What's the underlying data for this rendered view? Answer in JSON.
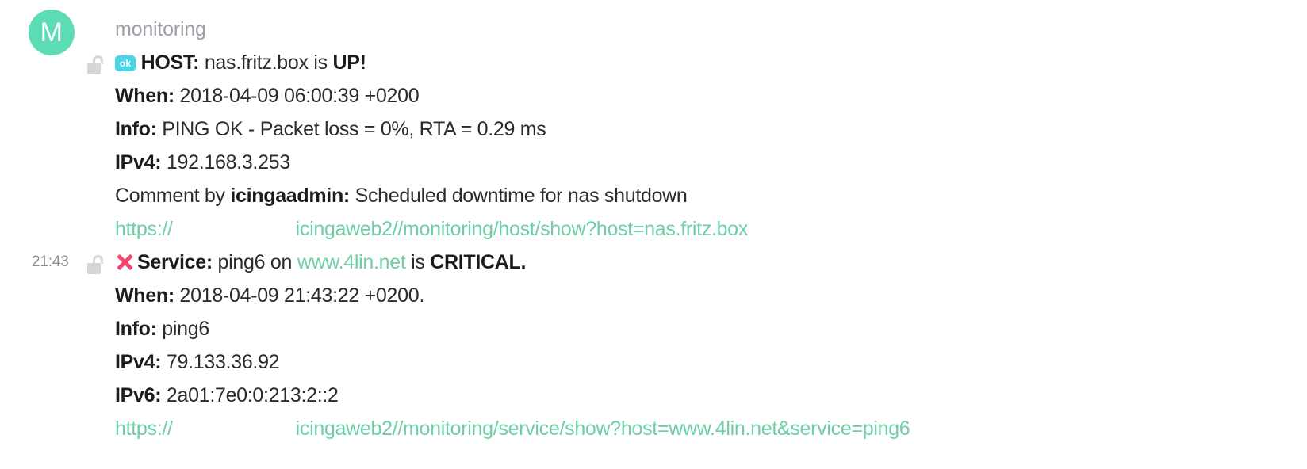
{
  "app": {
    "background_color": "#ffffff",
    "link_color": "#6ecfa4",
    "text_color": "#1d1c1d"
  },
  "message_group": {
    "avatar": {
      "initial": "M",
      "color": "#5bdcb4"
    },
    "sender": "monitoring"
  },
  "messages": [
    {
      "timestamp": "",
      "lock_icon": "unlocked-padlock-icon",
      "status_badge": {
        "label": "ok",
        "color": "#4ad5e6"
      },
      "title": {
        "prefix": "HOST:",
        "subject": " nas.fritz.box is ",
        "state": "UP!"
      },
      "fields": [
        {
          "label": "When:",
          "value": " 2018-04-09 06:00:39 +0200"
        },
        {
          "label": "Info:",
          "value": " PING OK - Packet loss = 0%, RTA = 0.29 ms"
        },
        {
          "label": "IPv4:",
          "value": " 192.168.3.253"
        }
      ],
      "comment": {
        "prefix": "Comment by ",
        "author": "icingaadmin:",
        "text": " Scheduled downtime for nas shutdown"
      },
      "url": {
        "scheme": "https://",
        "redacted": "",
        "path": "icingaweb2//monitoring/host/show?host=nas.fritz.box"
      }
    },
    {
      "timestamp": "21:43",
      "lock_icon": "unlocked-padlock-icon",
      "status_icon": {
        "name": "cross-mark-icon",
        "color": "#f6456e"
      },
      "title": {
        "prefix": "Service:",
        "subject": " ping6 on ",
        "host_link": "www.4lin.net",
        "connector": " is ",
        "state": "CRITICAL."
      },
      "fields": [
        {
          "label": "When:",
          "value": " 2018-04-09 21:43:22 +0200."
        },
        {
          "label": "Info:",
          "value": " ping6"
        },
        {
          "label": "IPv4:",
          "value": " 79.133.36.92"
        },
        {
          "label": "IPv6:",
          "value": " 2a01:7e0:0:213:2::2"
        }
      ],
      "url": {
        "scheme": "https://",
        "redacted": "",
        "path": "icingaweb2//monitoring/service/show?host=www.4lin.net&service=ping6"
      }
    }
  ]
}
